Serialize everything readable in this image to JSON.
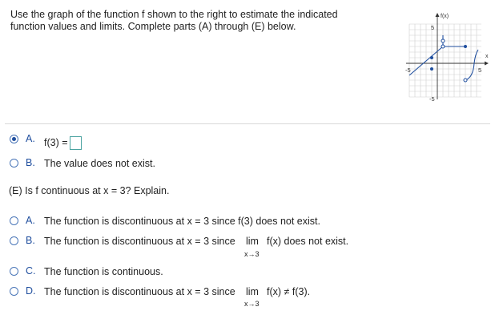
{
  "prompt": {
    "line1": "Use the graph of the function f shown to the right to estimate the indicated",
    "line2": "function values and limits. Complete parts (A) through (E) below."
  },
  "graph": {
    "ylabel": "f(x)",
    "xlabel": "x",
    "tick_y_top": "5",
    "tick_y_bottom": "-5",
    "tick_x_left": "-5",
    "tick_x_right": "5",
    "line_color": "#1f4e9e"
  },
  "part_d": {
    "options": [
      {
        "letter": "A.",
        "text_before": "f(3) =",
        "selected": true
      },
      {
        "letter": "B.",
        "text": "The value does not exist.",
        "selected": false
      }
    ]
  },
  "part_e": {
    "question": "(E) Is f continuous at x = 3? Explain.",
    "options": [
      {
        "letter": "A.",
        "text": "The function is discontinuous at x = 3 since f(3) does not exist."
      },
      {
        "letter": "B.",
        "text_before": "The function is discontinuous at x = 3 since",
        "lim": "lim",
        "sub": "x→3",
        "text_after": "f(x) does not exist."
      },
      {
        "letter": "C.",
        "text": "The function is continuous."
      },
      {
        "letter": "D.",
        "text_before": "The function is discontinuous at x = 3 since",
        "lim": "lim",
        "sub": "x→3",
        "text_after": "f(x) ≠ f(3)."
      }
    ]
  }
}
